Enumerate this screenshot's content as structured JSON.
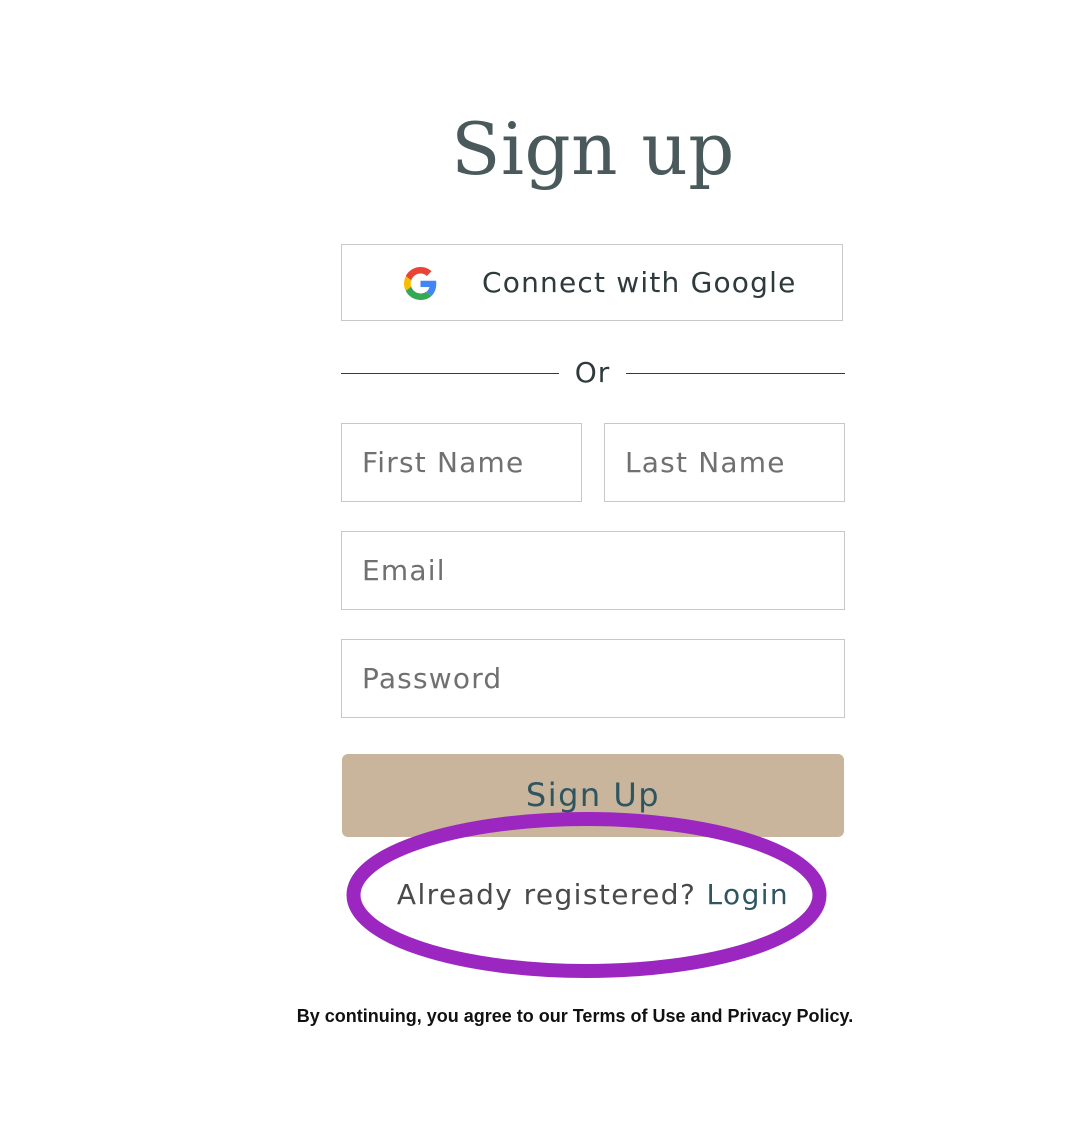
{
  "title": "Sign up",
  "google_button": {
    "label": "Connect with Google",
    "icon": "google-g-icon",
    "colors": {
      "blue": "#4285F4",
      "red": "#EA4335",
      "yellow": "#FBBC05",
      "green": "#34A853"
    }
  },
  "divider": {
    "label": "Or"
  },
  "form": {
    "first_name": {
      "placeholder": "First Name",
      "value": ""
    },
    "last_name": {
      "placeholder": "Last Name",
      "value": ""
    },
    "email": {
      "placeholder": "Email",
      "value": ""
    },
    "password": {
      "placeholder": "Password",
      "value": ""
    }
  },
  "submit": {
    "label": "Sign Up",
    "background": "#c8b59c",
    "text_color": "#2f5561"
  },
  "login_prompt": {
    "text": "Already registered?",
    "link_label": "Login"
  },
  "highlight": {
    "color": "#9b27c0"
  },
  "legal": {
    "text": "By continuing, you agree to our Terms of Use and Privacy Policy."
  }
}
